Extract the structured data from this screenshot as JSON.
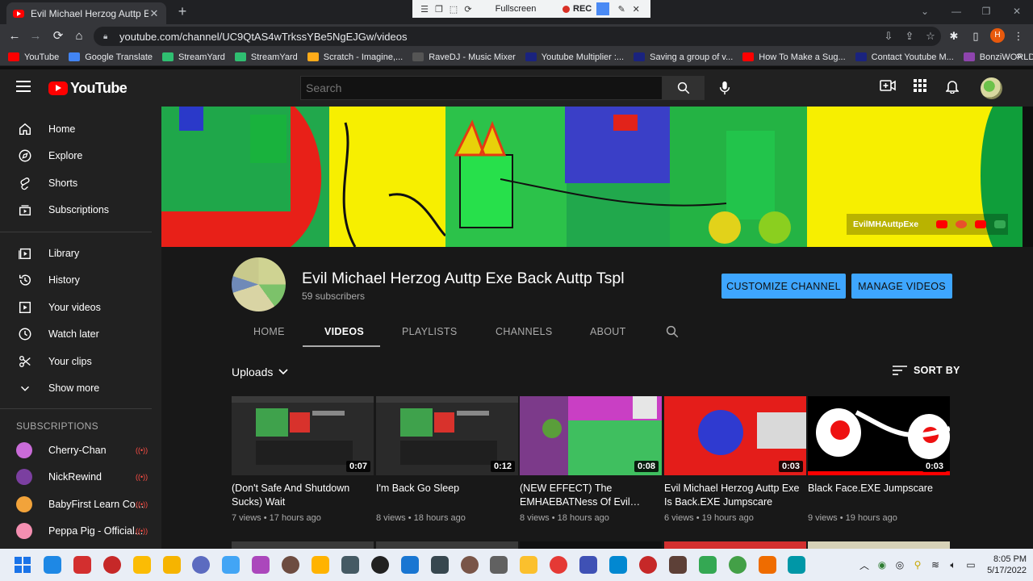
{
  "browser": {
    "tab_title": "Evil Michael Herzog Auttp Exe Ba",
    "tab_close": "✕",
    "new_tab": "+",
    "url": "youtube.com/channel/UC9QtAS4wTrkssYBe5NgEJGw/videos",
    "profile_initial": "H",
    "recorder": {
      "fullscreen_label": "Fullscreen",
      "rec_label": "REC"
    }
  },
  "bookmarks": [
    {
      "label": "YouTube",
      "color": "#ff0000"
    },
    {
      "label": "Google Translate",
      "color": "#4285f4"
    },
    {
      "label": "StreamYard",
      "color": "#2fbf71"
    },
    {
      "label": "StreamYard",
      "color": "#2fbf71"
    },
    {
      "label": "Scratch - Imagine,...",
      "color": "#ffab19"
    },
    {
      "label": "RaveDJ - Music Mixer",
      "color": "#555555"
    },
    {
      "label": "Youtube Multiplier :...",
      "color": "#1a237e"
    },
    {
      "label": "Saving a group of v...",
      "color": "#1a237e"
    },
    {
      "label": "How To Make a Sug...",
      "color": "#ff0000"
    },
    {
      "label": "Contact Youtube M...",
      "color": "#1a237e"
    },
    {
      "label": "BonziWORLD - The...",
      "color": "#8e44ad"
    }
  ],
  "bookmarks_more": "»",
  "youtube": {
    "logo_text": "YouTube",
    "search_placeholder": "Search"
  },
  "sidebar": {
    "main": [
      {
        "label": "Home",
        "icon": "home-icon"
      },
      {
        "label": "Explore",
        "icon": "compass-icon"
      },
      {
        "label": "Shorts",
        "icon": "shorts-icon"
      },
      {
        "label": "Subscriptions",
        "icon": "subscriptions-icon"
      }
    ],
    "library": [
      {
        "label": "Library",
        "icon": "library-icon"
      },
      {
        "label": "History",
        "icon": "history-icon"
      },
      {
        "label": "Your videos",
        "icon": "your-videos-icon"
      },
      {
        "label": "Watch later",
        "icon": "clock-icon"
      },
      {
        "label": "Your clips",
        "icon": "scissors-icon"
      },
      {
        "label": "Show more",
        "icon": "chevron-down-icon"
      }
    ],
    "subscriptions_heading": "SUBSCRIPTIONS",
    "subscriptions": [
      {
        "label": "Cherry-Chan",
        "color": "#c96bd8"
      },
      {
        "label": "NickRewind",
        "color": "#7b3fa0"
      },
      {
        "label": "BabyFirst Learn Co...",
        "color": "#f2a33a"
      },
      {
        "label": "Peppa Pig - Official...",
        "color": "#f48fb1"
      }
    ]
  },
  "banner": {
    "link_text": "EvilMHAuttpExe"
  },
  "channel": {
    "name": "Evil Michael Herzog Auttp Exe Back Auttp Tspl",
    "subscribers": "59 subscribers",
    "customize_label": "CUSTOMIZE CHANNEL",
    "manage_label": "MANAGE VIDEOS",
    "tabs": [
      "HOME",
      "VIDEOS",
      "PLAYLISTS",
      "CHANNELS",
      "ABOUT"
    ],
    "active_tab": "VIDEOS"
  },
  "videos_section": {
    "uploads_label": "Uploads",
    "sort_label": "SORT BY",
    "videos": [
      {
        "title": "(Don't Safe And Shutdown Sucks) Wait",
        "views": "7 views",
        "age": "17 hours ago",
        "duration": "0:07"
      },
      {
        "title": "I'm Back Go Sleep",
        "views": "8 views",
        "age": "18 hours ago",
        "duration": "0:12"
      },
      {
        "title": "(NEW EFFECT) The EMHAEBATNess Of Evil…",
        "views": "8 views",
        "age": "18 hours ago",
        "duration": "0:08"
      },
      {
        "title": "Evil Michael Herzog Auttp Exe Is Back.EXE Jumpscare",
        "views": "6 views",
        "age": "19 hours ago",
        "duration": "0:03"
      },
      {
        "title": "Black Face.EXE Jumpscare",
        "views": "9 views",
        "age": "19 hours ago",
        "duration": "0:03"
      }
    ]
  },
  "taskbar": {
    "time": "8:05 PM",
    "date": "5/17/2022"
  }
}
